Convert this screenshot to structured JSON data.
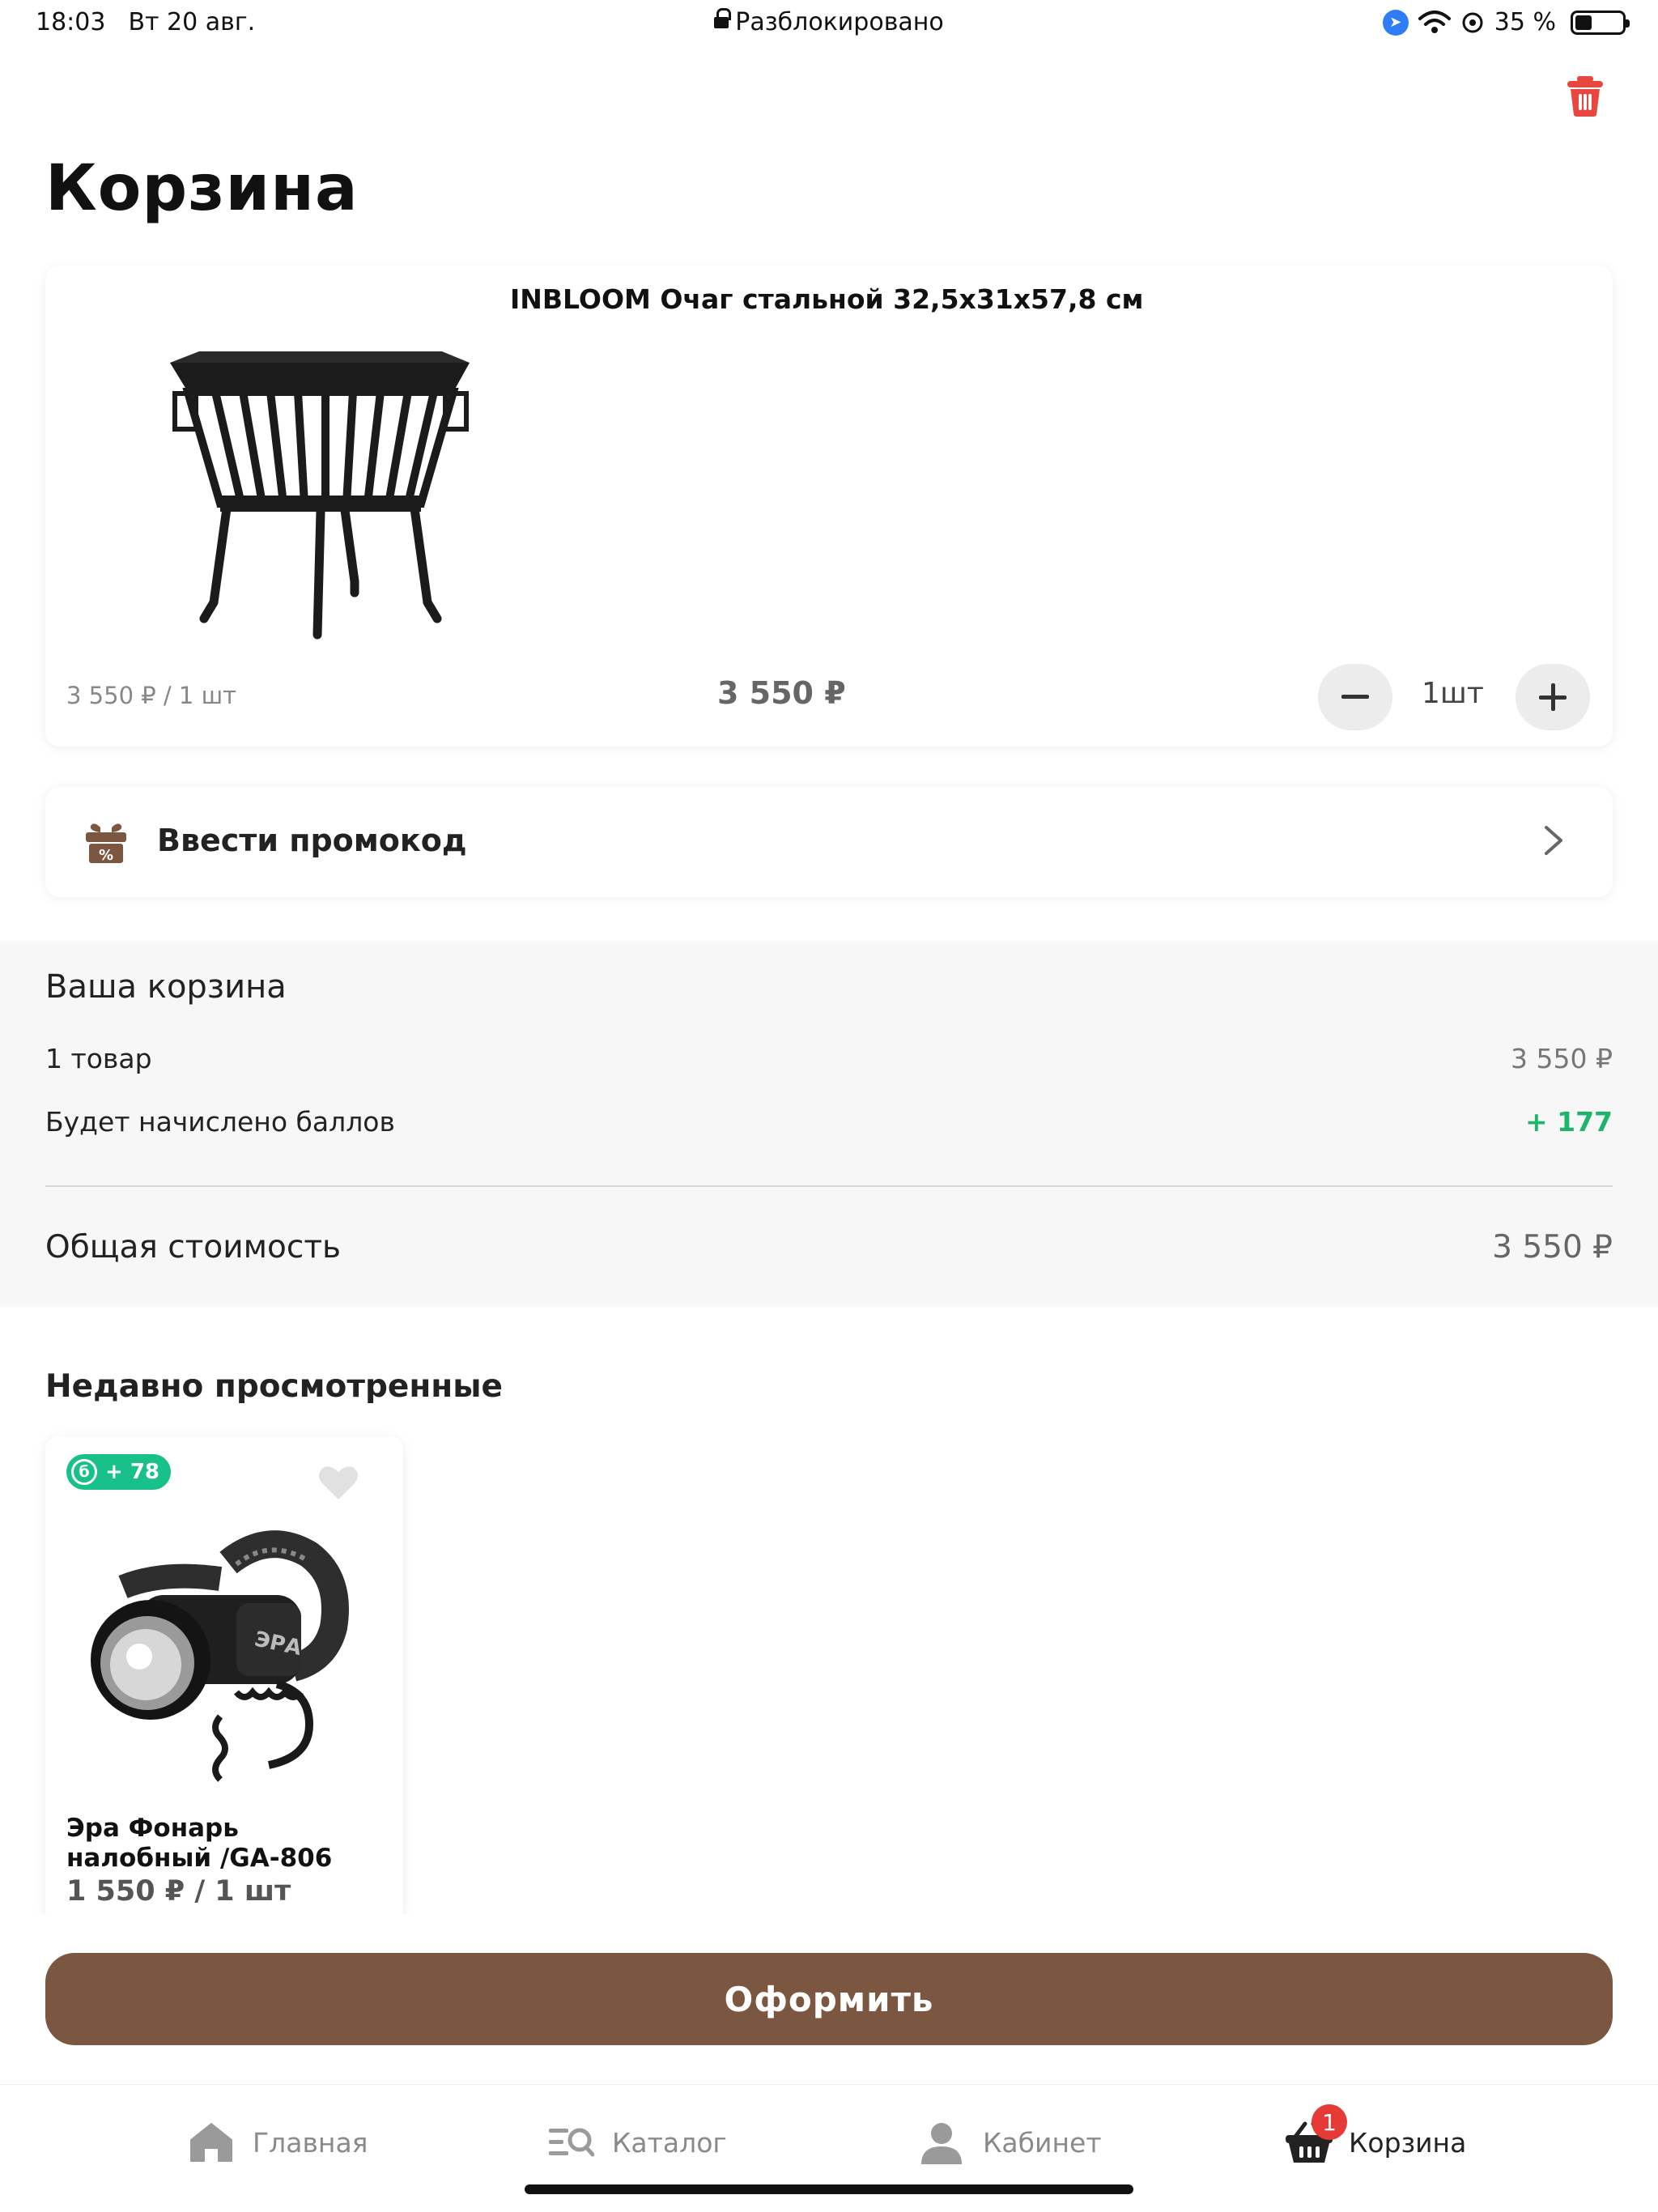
{
  "status_bar": {
    "time": "18:03",
    "date": "Вт 20 авг.",
    "lock_status": "Разблокировано",
    "battery": "35 %",
    "battery_level": 0.35,
    "icons": [
      "location-icon",
      "wifi-icon",
      "vpn-icon",
      "battery-icon"
    ]
  },
  "page": {
    "title": "Корзина"
  },
  "cart_item": {
    "title": "INBLOOM Очаг стальной 32,5x31x57,8 см",
    "unit_price": "3 550 ₽ / 1 шт",
    "total": "3 550 ₽",
    "quantity": "1шт",
    "minus_label": "−",
    "plus_label": "+"
  },
  "promo": {
    "label": "Ввести промокод"
  },
  "summary": {
    "title": "Ваша корзина",
    "items_label": "1 товар",
    "items_value": "3 550 ₽",
    "bonus_label": "Будет начислено баллов",
    "bonus_value": "+ 177",
    "total_label": "Общая стоимость",
    "total_value": "3 550 ₽"
  },
  "recent": {
    "title": "Недавно просмотренные",
    "items": [
      {
        "badge_letter": "б",
        "badge_points": "+ 78",
        "name": "Эра Фонарь налобный /GA-806",
        "price": "1 550 ₽ / 1 шт"
      }
    ]
  },
  "checkout": {
    "label": "Оформить"
  },
  "tabs": [
    {
      "label": "Главная",
      "icon": "home-icon"
    },
    {
      "label": "Каталог",
      "icon": "catalog-icon"
    },
    {
      "label": "Кабинет",
      "icon": "profile-icon"
    },
    {
      "label": "Корзина",
      "icon": "basket-icon",
      "badge": "1"
    }
  ],
  "colors": {
    "accent_brown": "#7b5641",
    "bonus_green": "#18c08a",
    "delete_red": "#e8473f",
    "badge_red": "#e53a35"
  }
}
